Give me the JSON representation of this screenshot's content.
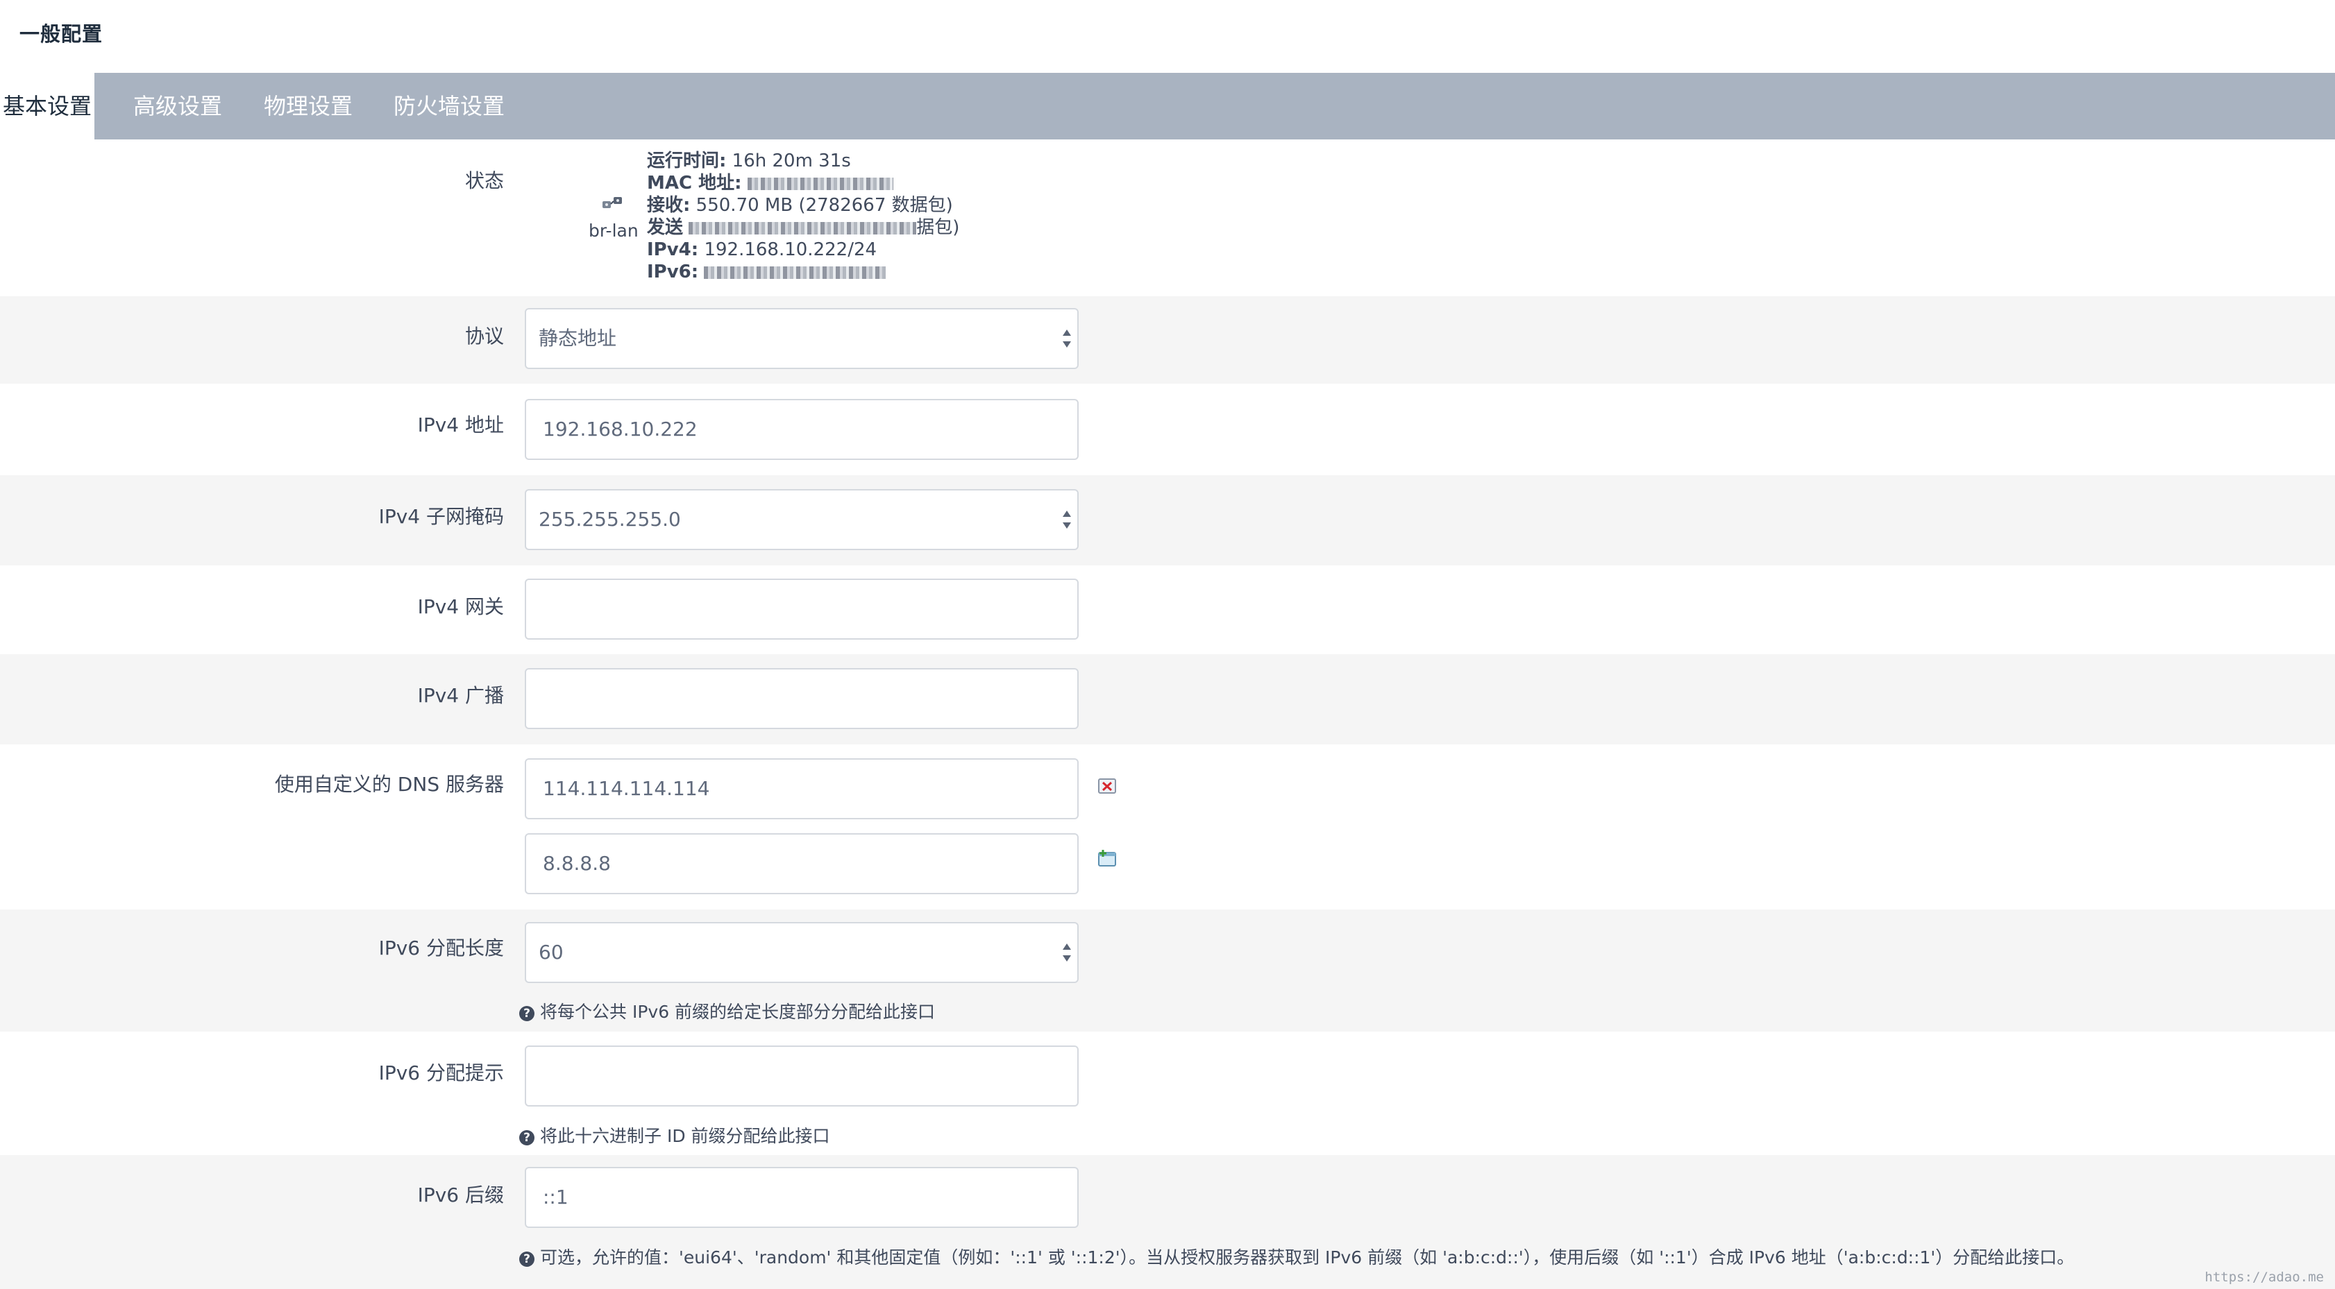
{
  "page": {
    "title": "一般配置"
  },
  "tabs": [
    {
      "label": "基本设置",
      "active": true
    },
    {
      "label": "高级设置",
      "active": false
    },
    {
      "label": "物理设置",
      "active": false
    },
    {
      "label": "防火墙设置",
      "active": false
    }
  ],
  "status": {
    "label": "状态",
    "interface": "br-lan",
    "uptime_key": "运行时间:",
    "uptime_value": "16h 20m 31s",
    "mac_key": "MAC 地址:",
    "rx_key": "接收:",
    "rx_value": "550.70 MB (2782667 数据包)",
    "tx_key": "发送",
    "tx_tail": "据包)",
    "ipv4_key": "IPv4:",
    "ipv4_value": "192.168.10.222/24",
    "ipv6_key": "IPv6:"
  },
  "form": {
    "protocol": {
      "label": "协议",
      "value": "静态地址"
    },
    "ipv4_address": {
      "label": "IPv4 地址",
      "value": "192.168.10.222"
    },
    "ipv4_netmask": {
      "label": "IPv4 子网掩码",
      "value": "255.255.255.0"
    },
    "ipv4_gateway": {
      "label": "IPv4 网关",
      "value": ""
    },
    "ipv4_broadcast": {
      "label": "IPv4 广播",
      "value": ""
    },
    "dns": {
      "label": "使用自定义的 DNS 服务器",
      "values": [
        "114.114.114.114",
        "8.8.8.8"
      ]
    },
    "ipv6_assign_length": {
      "label": "IPv6 分配长度",
      "value": "60",
      "hint": "将每个公共 IPv6 前缀的给定长度部分分配给此接口"
    },
    "ipv6_assign_hint": {
      "label": "IPv6 分配提示",
      "value": "",
      "hint": "将此十六进制子 ID 前缀分配给此接口"
    },
    "ipv6_suffix": {
      "label": "IPv6 后缀",
      "value": "::1",
      "hint": "可选，允许的值：'eui64'、'random' 和其他固定值（例如：'::1' 或 '::1:2'）。当从授权服务器获取到 IPv6 前缀（如 'a:b:c:d::'），使用后缀（如 '::1'）合成 IPv6 地址（'a:b:c:d::1'）分配给此接口。"
    }
  },
  "icons": {
    "status": "network-interface-icon",
    "dns_remove": "remove-entry-icon",
    "dns_add": "add-entry-icon",
    "hint": "help-icon"
  },
  "watermark": "https://adao.me"
}
